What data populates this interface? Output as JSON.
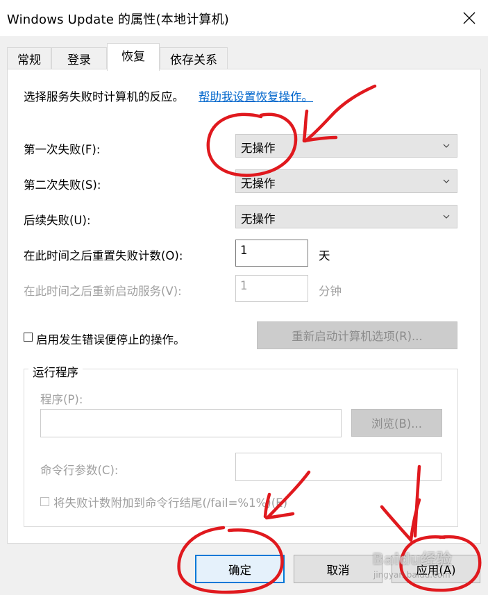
{
  "window": {
    "title": "Windows Update 的属性(本地计算机)"
  },
  "tabs": [
    {
      "label": "常规",
      "active": false
    },
    {
      "label": "登录",
      "active": false
    },
    {
      "label": "恢复",
      "active": true
    },
    {
      "label": "依存关系",
      "active": false
    }
  ],
  "recovery": {
    "intro_text": "选择服务失败时计算机的反应。",
    "help_link": "帮助我设置恢复操作。",
    "first_failure_label": "第一次失败(F):",
    "first_failure_value": "无操作",
    "second_failure_label": "第二次失败(S):",
    "second_failure_value": "无操作",
    "subsequent_failure_label": "后续失败(U):",
    "subsequent_failure_value": "无操作",
    "reset_count_label": "在此时间之后重置失败计数(O):",
    "reset_count_value": "1",
    "reset_count_unit": "天",
    "restart_service_label": "在此时间之后重新启动服务(V):",
    "restart_service_value": "1",
    "restart_service_unit": "分钟",
    "enable_actions_label": "启用发生错误便停止的操作。",
    "restart_computer_options_button": "重新启动计算机选项(R)..."
  },
  "run_program": {
    "group_title": "运行程序",
    "program_label": "程序(P):",
    "program_value": "",
    "browse_button": "浏览(B)...",
    "cmdline_label": "命令行参数(C):",
    "cmdline_value": "",
    "append_fail_count_label": "将失败计数附加到命令行结尾(/fail=%1%)(E)"
  },
  "footer": {
    "ok_button": "确定",
    "cancel_button": "取消",
    "apply_button": "应用(A)"
  },
  "watermark": {
    "text": "Baidu经验",
    "sub": "jingyan.baidu.com"
  },
  "colors": {
    "annotation_red": "#e0191e",
    "link_blue": "#0066cc",
    "accent_blue": "#0078d7"
  }
}
